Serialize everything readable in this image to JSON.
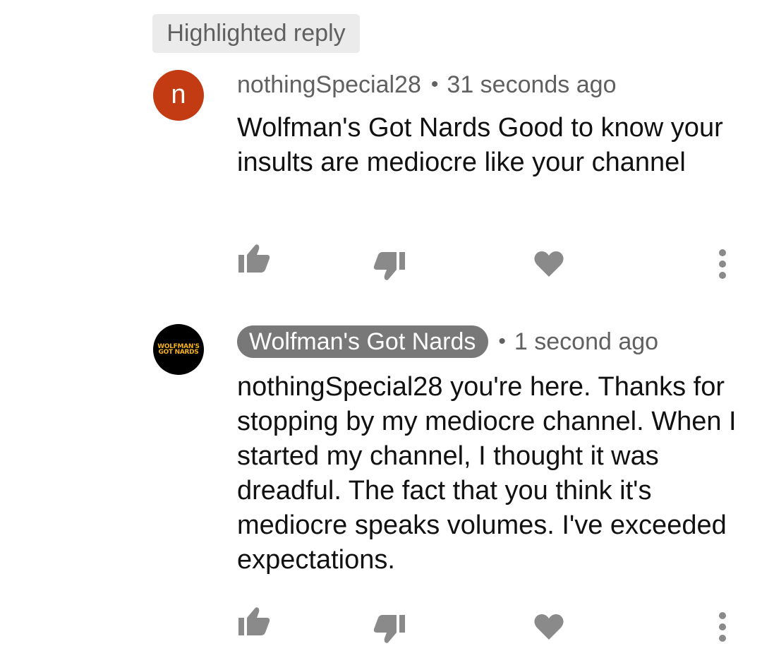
{
  "badge": {
    "label": "Highlighted reply"
  },
  "comments": [
    {
      "avatar_letter": "n",
      "avatar_color": "#c23b13",
      "author": "nothingSpecial28",
      "separator": "•",
      "time": "31 seconds ago",
      "text": "Wolfman's Got Nards Good to know your insults are mediocre like your channel",
      "actions": [
        "thumbs-up-icon",
        "thumbs-down-icon",
        "heart-icon",
        "more-vert-icon"
      ]
    },
    {
      "avatar_logo_line1": "WOLFMAN'S",
      "avatar_logo_line2": "GOT NARDS",
      "avatar_color": "#000000",
      "author": "Wolfman's Got Nards",
      "author_is_creator": true,
      "separator": "•",
      "time": "1 second ago",
      "text": "nothingSpecial28 you're here. Thanks for stopping by my mediocre channel. When I started my channel, I thought it was dreadful. The fact that you think it's mediocre speaks volumes. I've exceeded expectations.",
      "actions": [
        "thumbs-up-icon",
        "thumbs-down-icon",
        "heart-icon",
        "more-vert-icon"
      ]
    }
  ],
  "colors": {
    "icon_gray": "#8a8a8a",
    "meta_gray": "#606060",
    "creator_pill": "#787878",
    "badge_bg": "#ebebeb",
    "logo_yellow": "#f6b21c"
  }
}
